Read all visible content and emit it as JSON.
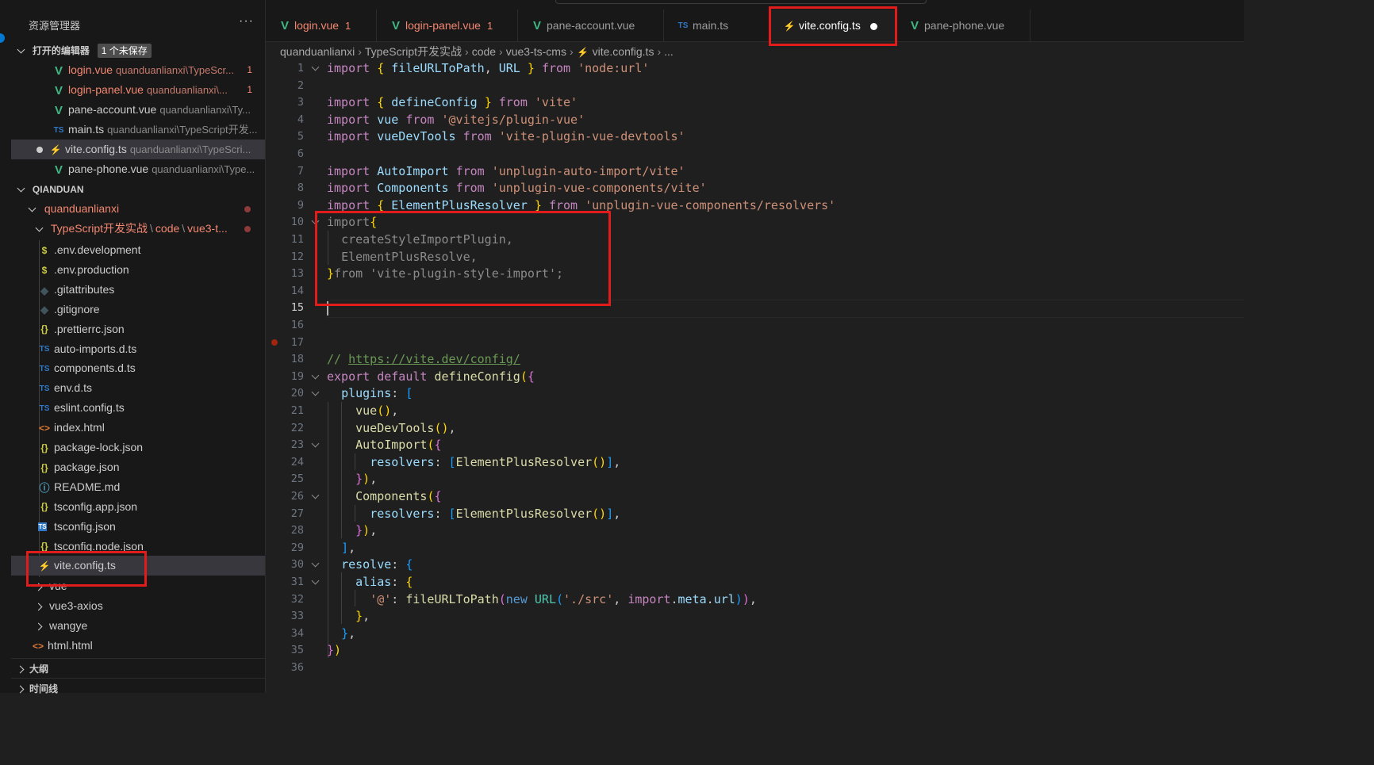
{
  "sidebar": {
    "title": "资源管理器",
    "more": "···",
    "open_editors": {
      "title": "打开的编辑器",
      "badge": "1 个未保存",
      "items": [
        {
          "name": "login.vue",
          "path": "quanduanlianxi\\TypeScr...",
          "errors": "1",
          "icon": "vue-icon"
        },
        {
          "name": "login-panel.vue",
          "path": "quanduanlianxi\\...",
          "errors": "1",
          "icon": "vue-icon"
        },
        {
          "name": "pane-account.vue",
          "path": "quanduanlianxi\\Ty...",
          "icon": "vue-icon"
        },
        {
          "name": "main.ts",
          "path": "quanduanlianxi\\TypeScript开发...",
          "icon": "ts-icon"
        },
        {
          "name": "vite.config.ts",
          "path": "quanduanlianxi\\TypeScri...",
          "icon": "bolt-icon",
          "unsaved": true
        },
        {
          "name": "pane-phone.vue",
          "path": "quanduanlianxi\\Type...",
          "icon": "vue-icon"
        }
      ]
    },
    "workspace": {
      "title": "QIANDUAN",
      "folder": "quanduanlianxi",
      "subfolder_parts": [
        "TypeScript开发实战",
        "code",
        "vue3-t..."
      ],
      "subfolder_sep": "\\",
      "files": [
        {
          "name": ".env.development",
          "icon": "env-icon",
          "glyph": "$"
        },
        {
          "name": ".env.production",
          "icon": "env-icon",
          "glyph": "$"
        },
        {
          "name": ".gitattributes",
          "icon": "git-icon",
          "glyph": "◆"
        },
        {
          "name": ".gitignore",
          "icon": "git-icon",
          "glyph": "◆"
        },
        {
          "name": ".prettierrc.json",
          "icon": "json-icon",
          "glyph": "{}"
        },
        {
          "name": "auto-imports.d.ts",
          "icon": "ts-icon",
          "glyph": "TS"
        },
        {
          "name": "components.d.ts",
          "icon": "ts-icon",
          "glyph": "TS"
        },
        {
          "name": "env.d.ts",
          "icon": "ts-icon",
          "glyph": "TS"
        },
        {
          "name": "eslint.config.ts",
          "icon": "ts-icon",
          "glyph": "TS"
        },
        {
          "name": "index.html",
          "icon": "html-icon",
          "glyph": "<>"
        },
        {
          "name": "package-lock.json",
          "icon": "json-icon",
          "glyph": "{}"
        },
        {
          "name": "package.json",
          "icon": "json-icon",
          "glyph": "{}"
        },
        {
          "name": "README.md",
          "icon": "info-icon",
          "glyph": "ⓘ"
        },
        {
          "name": "tsconfig.app.json",
          "icon": "json-icon",
          "glyph": "{}"
        },
        {
          "name": "tsconfig.json",
          "icon": "tsconfig-icon",
          "glyph": "TS"
        },
        {
          "name": "tsconfig.node.json",
          "icon": "json-icon",
          "glyph": "{}"
        },
        {
          "name": "vite.config.ts",
          "icon": "bolt-icon",
          "glyph": "⚡"
        }
      ],
      "folders_after": [
        "vue",
        "vue3-axios",
        "wangye"
      ],
      "root_file": "html.html"
    },
    "outline": "大纲",
    "timeline": "时间线"
  },
  "tabs": [
    {
      "name": "login.vue",
      "errors": "1",
      "icon": "vue-icon",
      "error_state": true
    },
    {
      "name": "login-panel.vue",
      "errors": "1",
      "icon": "vue-icon",
      "error_state": true
    },
    {
      "name": "pane-account.vue",
      "icon": "vue-icon"
    },
    {
      "name": "main.ts",
      "icon": "ts-icon"
    },
    {
      "name": "vite.config.ts",
      "icon": "bolt-icon",
      "active": true,
      "unsaved": true
    },
    {
      "name": "pane-phone.vue",
      "icon": "vue-icon"
    }
  ],
  "breadcrumb": [
    "quanduanlianxi",
    "TypeScript开发实战",
    "code",
    "vue3-ts-cms",
    "vite.config.ts",
    "..."
  ],
  "editor": {
    "current_line": 15,
    "lines": [
      [
        [
          "k",
          "import"
        ],
        [
          "g",
          " "
        ],
        [
          "y",
          "{"
        ],
        [
          "g",
          " "
        ],
        [
          "v",
          "fileURLToPath"
        ],
        [
          "g",
          ", "
        ],
        [
          "v",
          "URL"
        ],
        [
          "g",
          " "
        ],
        [
          "y",
          "}"
        ],
        [
          "g",
          " "
        ],
        [
          "k",
          "from"
        ],
        [
          "g",
          " "
        ],
        [
          "s",
          "'node:url'"
        ]
      ],
      [],
      [
        [
          "k",
          "import"
        ],
        [
          "g",
          " "
        ],
        [
          "y",
          "{"
        ],
        [
          "g",
          " "
        ],
        [
          "v",
          "defineConfig"
        ],
        [
          "g",
          " "
        ],
        [
          "y",
          "}"
        ],
        [
          "g",
          " "
        ],
        [
          "k",
          "from"
        ],
        [
          "g",
          " "
        ],
        [
          "s",
          "'vite'"
        ]
      ],
      [
        [
          "k",
          "import"
        ],
        [
          "g",
          " "
        ],
        [
          "v",
          "vue"
        ],
        [
          "g",
          " "
        ],
        [
          "k",
          "from"
        ],
        [
          "g",
          " "
        ],
        [
          "s",
          "'@vitejs/plugin-vue'"
        ]
      ],
      [
        [
          "k",
          "import"
        ],
        [
          "g",
          " "
        ],
        [
          "v",
          "vueDevTools"
        ],
        [
          "g",
          " "
        ],
        [
          "k",
          "from"
        ],
        [
          "g",
          " "
        ],
        [
          "s",
          "'vite-plugin-vue-devtools'"
        ]
      ],
      [],
      [
        [
          "k",
          "import"
        ],
        [
          "g",
          " "
        ],
        [
          "v",
          "AutoImport"
        ],
        [
          "g",
          " "
        ],
        [
          "k",
          "from"
        ],
        [
          "g",
          " "
        ],
        [
          "s",
          "'unplugin-auto-import/vite'"
        ]
      ],
      [
        [
          "k",
          "import"
        ],
        [
          "g",
          " "
        ],
        [
          "v",
          "Components"
        ],
        [
          "g",
          " "
        ],
        [
          "k",
          "from"
        ],
        [
          "g",
          " "
        ],
        [
          "s",
          "'unplugin-vue-components/vite'"
        ]
      ],
      [
        [
          "k",
          "import"
        ],
        [
          "g",
          " "
        ],
        [
          "y",
          "{"
        ],
        [
          "g",
          " "
        ],
        [
          "v",
          "ElementPlusResolver"
        ],
        [
          "g",
          " "
        ],
        [
          "y",
          "}"
        ],
        [
          "g",
          " "
        ],
        [
          "k",
          "from"
        ],
        [
          "g",
          " "
        ],
        [
          "s",
          "'unplugin-vue-components/resolvers'"
        ]
      ],
      [
        [
          "gray",
          "import"
        ],
        [
          "y",
          "{"
        ]
      ],
      [
        [
          "g",
          "  "
        ],
        [
          "gray",
          "createStyleImportPlugin,"
        ]
      ],
      [
        [
          "g",
          "  "
        ],
        [
          "gray",
          "ElementPlusResolve,"
        ]
      ],
      [
        [
          "y",
          "}"
        ],
        [
          "gray",
          "from "
        ],
        [
          "gray",
          "'vite-plugin-style-import'"
        ],
        [
          "gray",
          ";"
        ]
      ],
      [],
      [],
      [],
      [],
      [
        [
          "c",
          "// "
        ],
        [
          "u",
          "https://vite.dev/config/"
        ]
      ],
      [
        [
          "k",
          "export"
        ],
        [
          "g",
          " "
        ],
        [
          "k",
          "default"
        ],
        [
          "g",
          " "
        ],
        [
          "f",
          "defineConfig"
        ],
        [
          "y",
          "("
        ],
        [
          "p",
          "{"
        ]
      ],
      [
        [
          "g",
          "  "
        ],
        [
          "v",
          "plugins"
        ],
        [
          "g",
          ": "
        ],
        [
          "q",
          "["
        ]
      ],
      [
        [
          "g",
          "    "
        ],
        [
          "f",
          "vue"
        ],
        [
          "y",
          "()"
        ],
        [
          "g",
          ","
        ]
      ],
      [
        [
          "g",
          "    "
        ],
        [
          "f",
          "vueDevTools"
        ],
        [
          "y",
          "()"
        ],
        [
          "g",
          ","
        ]
      ],
      [
        [
          "g",
          "    "
        ],
        [
          "f",
          "AutoImport"
        ],
        [
          "y",
          "("
        ],
        [
          "p",
          "{"
        ]
      ],
      [
        [
          "g",
          "      "
        ],
        [
          "v",
          "resolvers"
        ],
        [
          "g",
          ": "
        ],
        [
          "q",
          "["
        ],
        [
          "f",
          "ElementPlusResolver"
        ],
        [
          "y",
          "()"
        ],
        [
          "q",
          "]"
        ],
        [
          "g",
          ","
        ]
      ],
      [
        [
          "g",
          "    "
        ],
        [
          "p",
          "}"
        ],
        [
          "y",
          ")"
        ],
        [
          "g",
          ","
        ]
      ],
      [
        [
          "g",
          "    "
        ],
        [
          "f",
          "Components"
        ],
        [
          "y",
          "("
        ],
        [
          "p",
          "{"
        ]
      ],
      [
        [
          "g",
          "      "
        ],
        [
          "v",
          "resolvers"
        ],
        [
          "g",
          ": "
        ],
        [
          "q",
          "["
        ],
        [
          "f",
          "ElementPlusResolver"
        ],
        [
          "y",
          "()"
        ],
        [
          "q",
          "]"
        ],
        [
          "g",
          ","
        ]
      ],
      [
        [
          "g",
          "    "
        ],
        [
          "p",
          "}"
        ],
        [
          "y",
          ")"
        ],
        [
          "g",
          ","
        ]
      ],
      [
        [
          "g",
          "  "
        ],
        [
          "q",
          "]"
        ],
        [
          "g",
          ","
        ]
      ],
      [
        [
          "g",
          "  "
        ],
        [
          "v",
          "resolve"
        ],
        [
          "g",
          ": "
        ],
        [
          "q",
          "{"
        ]
      ],
      [
        [
          "g",
          "    "
        ],
        [
          "v",
          "alias"
        ],
        [
          "g",
          ": "
        ],
        [
          "y",
          "{"
        ]
      ],
      [
        [
          "g",
          "      "
        ],
        [
          "s",
          "'@'"
        ],
        [
          "g",
          ": "
        ],
        [
          "f",
          "fileURLToPath"
        ],
        [
          "p",
          "("
        ],
        [
          "b",
          "new"
        ],
        [
          "g",
          " "
        ],
        [
          "t",
          "URL"
        ],
        [
          "q",
          "("
        ],
        [
          "s",
          "'./src'"
        ],
        [
          "g",
          ", "
        ],
        [
          "k",
          "import"
        ],
        [
          "g",
          "."
        ],
        [
          "v",
          "meta"
        ],
        [
          "g",
          "."
        ],
        [
          "v",
          "url"
        ],
        [
          "q",
          ")"
        ],
        [
          "p",
          ")"
        ],
        [
          "g",
          ","
        ]
      ],
      [
        [
          "g",
          "    "
        ],
        [
          "y",
          "}"
        ],
        [
          "g",
          ","
        ]
      ],
      [
        [
          "g",
          "  "
        ],
        [
          "q",
          "}"
        ],
        [
          "g",
          ","
        ]
      ],
      [
        [
          "p",
          "}"
        ],
        [
          "y",
          ")"
        ]
      ],
      []
    ],
    "fold_lines": [
      1,
      10,
      19,
      20,
      23,
      26,
      30,
      31
    ],
    "breakpoint_line": 17
  },
  "colors": {
    "highlight": "#e21b1b",
    "vue": "#41b883",
    "ts": "#3178c6",
    "error": "#f48771"
  }
}
